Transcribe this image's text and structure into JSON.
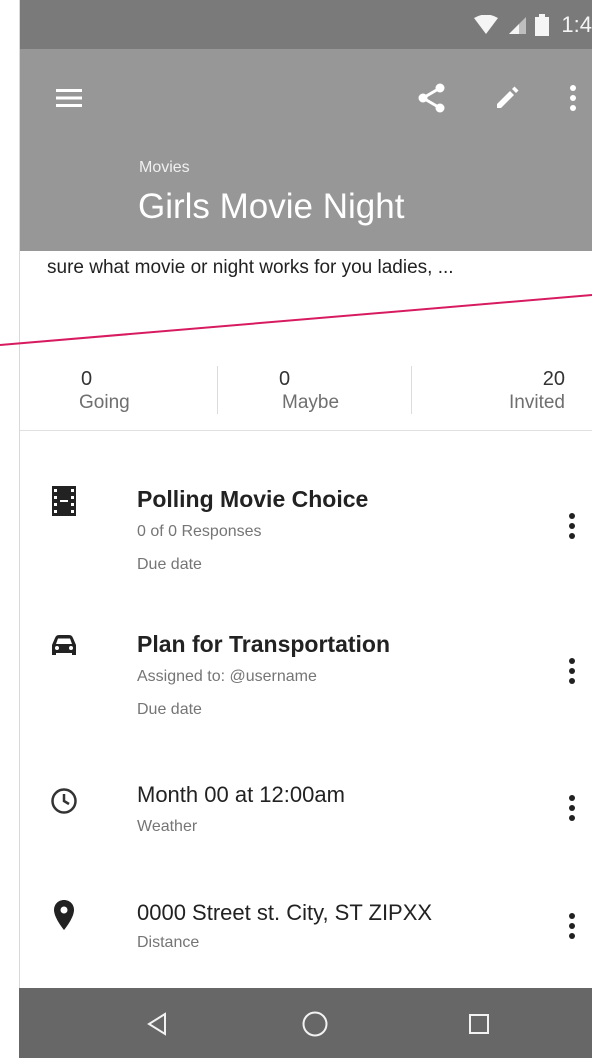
{
  "status_bar": {
    "time": "1:4"
  },
  "header": {
    "category": "Movies",
    "title": "Girls Movie Night"
  },
  "description": "sure what movie or night works for you ladies, ...",
  "stats": [
    {
      "count": "0",
      "label": "Going"
    },
    {
      "count": "0",
      "label": "Maybe"
    },
    {
      "count": "20",
      "label": "Invited"
    }
  ],
  "items": [
    {
      "icon": "film-icon",
      "title": "Polling Movie Choice",
      "line1": "0 of 0 Responses",
      "line2": "Due date"
    },
    {
      "icon": "car-icon",
      "title": "Plan for Transportation",
      "line1": "Assigned to: @username",
      "line2": "Due date"
    },
    {
      "icon": "clock-icon",
      "title": "Month 00 at 12:00am",
      "line1": "Weather"
    },
    {
      "icon": "location-pin-icon",
      "title": "0000 Street st. City, ST ZIPXX",
      "line1": "Distance"
    }
  ],
  "colors": {
    "status_bar": "#7a7a7a",
    "app_bar": "#979797",
    "nav_bar": "#676767",
    "accent_line": "#d81b60"
  }
}
